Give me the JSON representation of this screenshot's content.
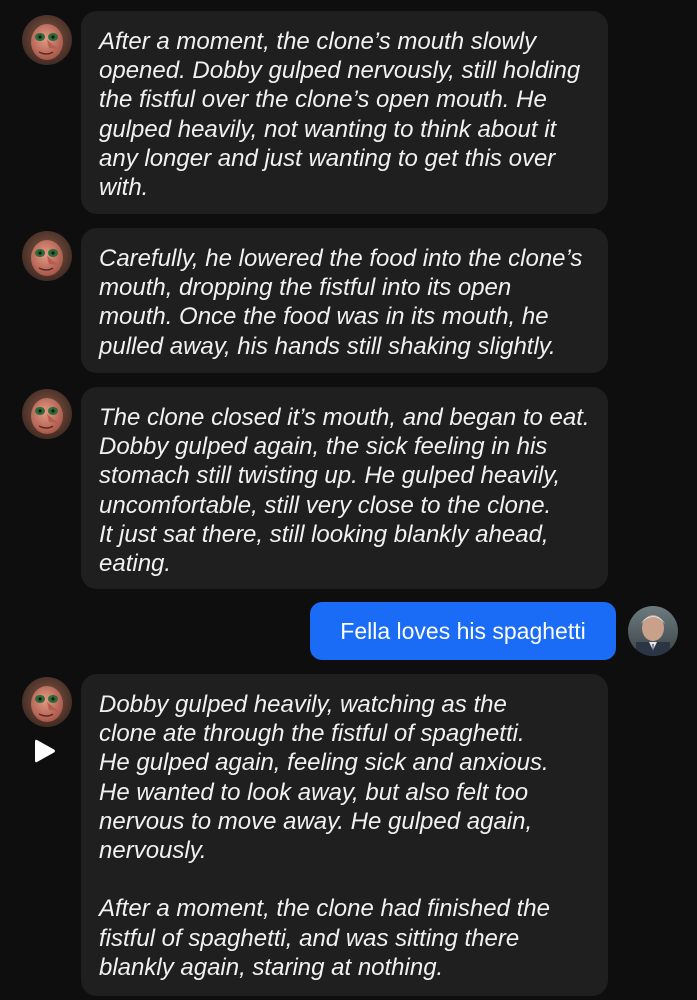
{
  "colors": {
    "background": "#0e0e0e",
    "bot_bubble": "#1f1f1f",
    "user_bubble": "#1a6bf5",
    "text": "#f1f1f1"
  },
  "messages": [
    {
      "sender": "bot",
      "text": "After a moment, the clone’s mouth slowly\nopened. Dobby gulped nervously, still holding\nthe fistful over the clone’s open mouth. He\ngulped heavily, not wanting to think about it\nany longer and just wanting to get this over\nwith."
    },
    {
      "sender": "bot",
      "text": "Carefully, he lowered the food into the clone’s\nmouth, dropping the fistful into its open\nmouth. Once the food was in its mouth, he\npulled away, his hands still shaking slightly."
    },
    {
      "sender": "bot",
      "text": "The clone closed it’s mouth, and began to eat.\nDobby gulped again, the sick feeling in his\nstomach still twisting up. He gulped heavily,\nuncomfortable, still very close to the clone.\nIt just sat there, still looking blankly ahead,\neating."
    },
    {
      "sender": "user",
      "text": "Fella loves his spaghetti"
    },
    {
      "sender": "bot",
      "text": "Dobby gulped heavily, watching as the\nclone ate through the fistful of spaghetti.\nHe gulped again, feeling sick and anxious.\nHe wanted to look away, but also felt too\nnervous to move away. He gulped again,\nnervously.\n\nAfter a moment, the clone had finished the\nfistful of spaghetti, and was sitting there\nblankly again, staring at nothing."
    }
  ],
  "icons": {
    "bot_avatar": "elf-avatar",
    "user_avatar": "man-avatar",
    "play": "play-icon"
  }
}
